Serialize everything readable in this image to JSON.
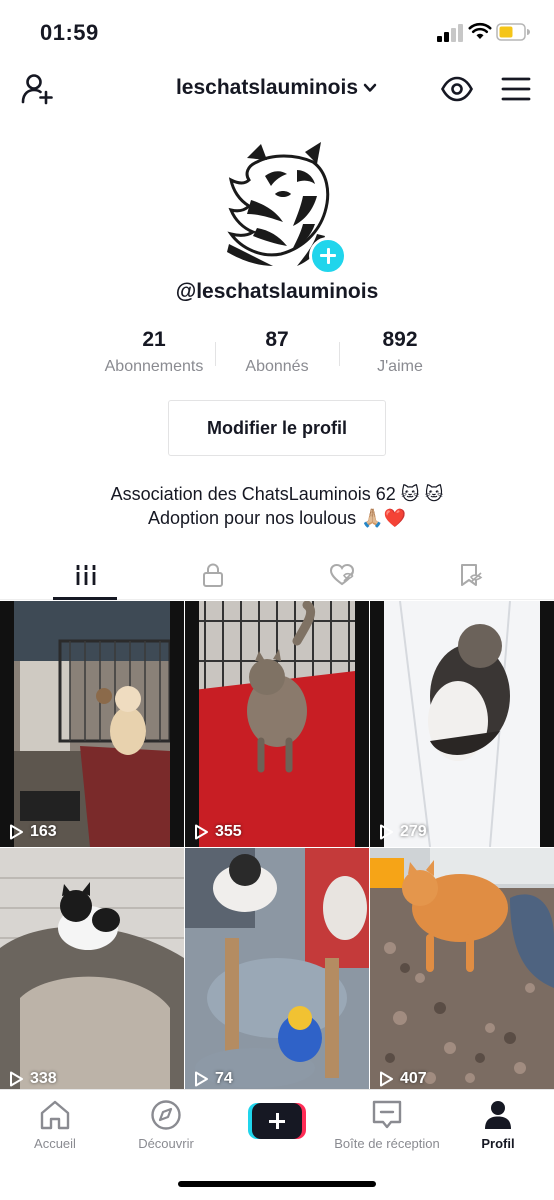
{
  "status_bar": {
    "time": "01:59"
  },
  "header": {
    "username": "leschatslauminois"
  },
  "profile": {
    "handle": "@leschatslauminois",
    "stats": [
      {
        "value": "21",
        "label": "Abonnements"
      },
      {
        "value": "87",
        "label": "Abonnés"
      },
      {
        "value": "892",
        "label": "J'aime"
      }
    ],
    "edit_button": "Modifier le profil",
    "bio_line1": "Association des ChatsLauminois 62 🐱 🐱",
    "bio_line2": "Adoption pour nos loulous 🙏🏼❤️"
  },
  "tabs": [
    "videos-grid-icon",
    "lock-icon",
    "liked-heart-icon",
    "bookmark-icon"
  ],
  "videos": [
    {
      "views": "163"
    },
    {
      "views": "355"
    },
    {
      "views": "279"
    },
    {
      "views": "338"
    },
    {
      "views": "74"
    },
    {
      "views": "407"
    }
  ],
  "bottom_nav": {
    "home": "Accueil",
    "discover": "Découvrir",
    "inbox": "Boîte de réception",
    "profile": "Profil"
  },
  "colors": {
    "accent_cyan": "#20d5ec",
    "accent_red": "#fe2c55",
    "text_dark": "#161823",
    "text_muted": "#8a8b91"
  }
}
